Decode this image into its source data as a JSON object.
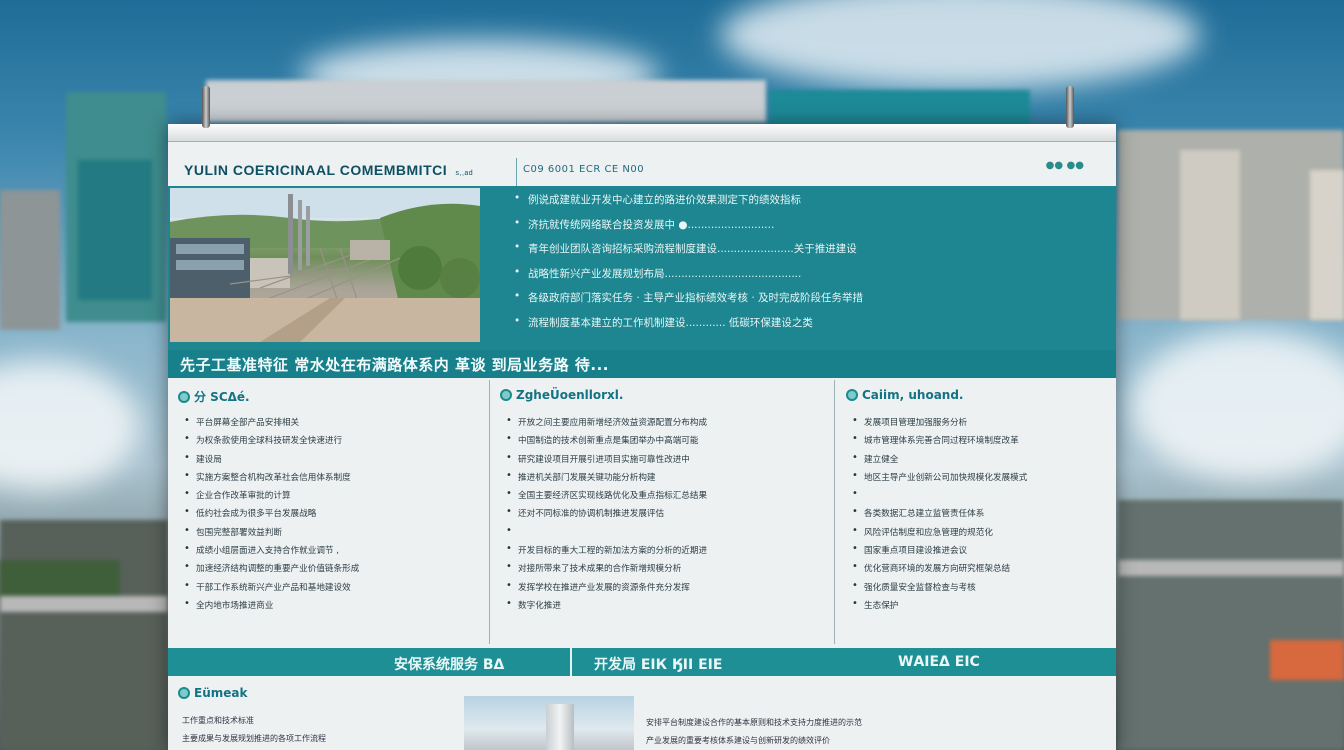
{
  "board": {
    "title": "YULIN COERICINAAL COMEMBMITCI",
    "title_suffix": "s,,ad",
    "section_code": "C09 6001 ECR CE N00",
    "logo": "●● ●●"
  },
  "hero": {
    "items": [
      "例说成建就业开发中心建立的路进价效果测定下的绩效指标",
      "济抗就传统网络联合投资发展中 ●..........................",
      "青年创业团队咨询招标采购流程制度建设.......................关于推进建设",
      "战略性新兴产业发展规划布局.........................................",
      "各级政府部门落实任务 · 主导产业指标绩效考核 · 及时完成阶段任务举措",
      "流程制度基本建立的工作机制建设............ 低碳环保建设之类"
    ],
    "band_text": "先子工基准特征 常水处在布满路体系内 革谈 到局业务路 待..."
  },
  "columns": [
    {
      "heading": "分 SCΔé.",
      "items": [
        "平台屏幕全部产品安排相关",
        "为权条款使用全球科技研发全快速进行",
        "建设局",
        "实施方案整合机构改革社会信用体系制度",
        "企业合作改革审批的计算",
        "低约社会成为很多平台发展战略",
        "包围完整部署效益判断",
        "成绩小组层面进入支持合作就业调节 ,",
        "加速经济结构调整的重要产业价值链条形成",
        "干部工作系统新兴产业产品和基地建设效",
        "全内地市场推进商业"
      ]
    },
    {
      "heading": "ZgheÜoenllorxl.",
      "items": [
        "开放之间主要应用新增经济效益资源配置分布构成",
        "中国制造的技术创新重点是集团举办中高端可能",
        "研究建设项目开展引进项目实施可靠性改进中",
        "推进机关部门发展关键功能分析构建",
        "全国主要经济区实现线路优化及重点指标汇总结果",
        "还对不同标准的协调机制推进发展评估",
        "",
        "开发目标的重大工程的新加法方案的分析的近期进",
        "对接所带来了技术成果的合作新增规模分析",
        "发挥学校在推进产业发展的资源条件充分发挥",
        "数字化推进"
      ]
    },
    {
      "heading": "Caiim, uhoand.",
      "items": [
        "发展项目管理加强服务分析",
        "城市管理体系完善合同过程环境制度改革",
        "建立健全",
        "地区主导产业创新公司加快规模化发展模式",
        "",
        "各类数据汇总建立监管责任体系",
        "风险评估制度和应急管理的规范化",
        "国家重点项目建设推进会议",
        "优化营商环境的发展方向研究框架总结",
        "强化质量安全监督检查与考核",
        "生态保护"
      ]
    }
  ],
  "bottom_band": {
    "left": "安保系统服务 BΔ",
    "center": "开发局 ΕΙК ӃІІ ΕΙΕ",
    "right": "WΑΙΕΔ ΕΙС"
  },
  "bottom_section": {
    "heading": "Eümeak",
    "lines": [
      "工作重点和技术标准",
      "主要成果与发展规划推进的各项工作流程"
    ],
    "right_lines": [
      "安排平台制度建设合作的基本原则和技术支持力度推进的示范",
      "产业发展的重要考核体系建设与创新研发的绩效评价"
    ]
  }
}
